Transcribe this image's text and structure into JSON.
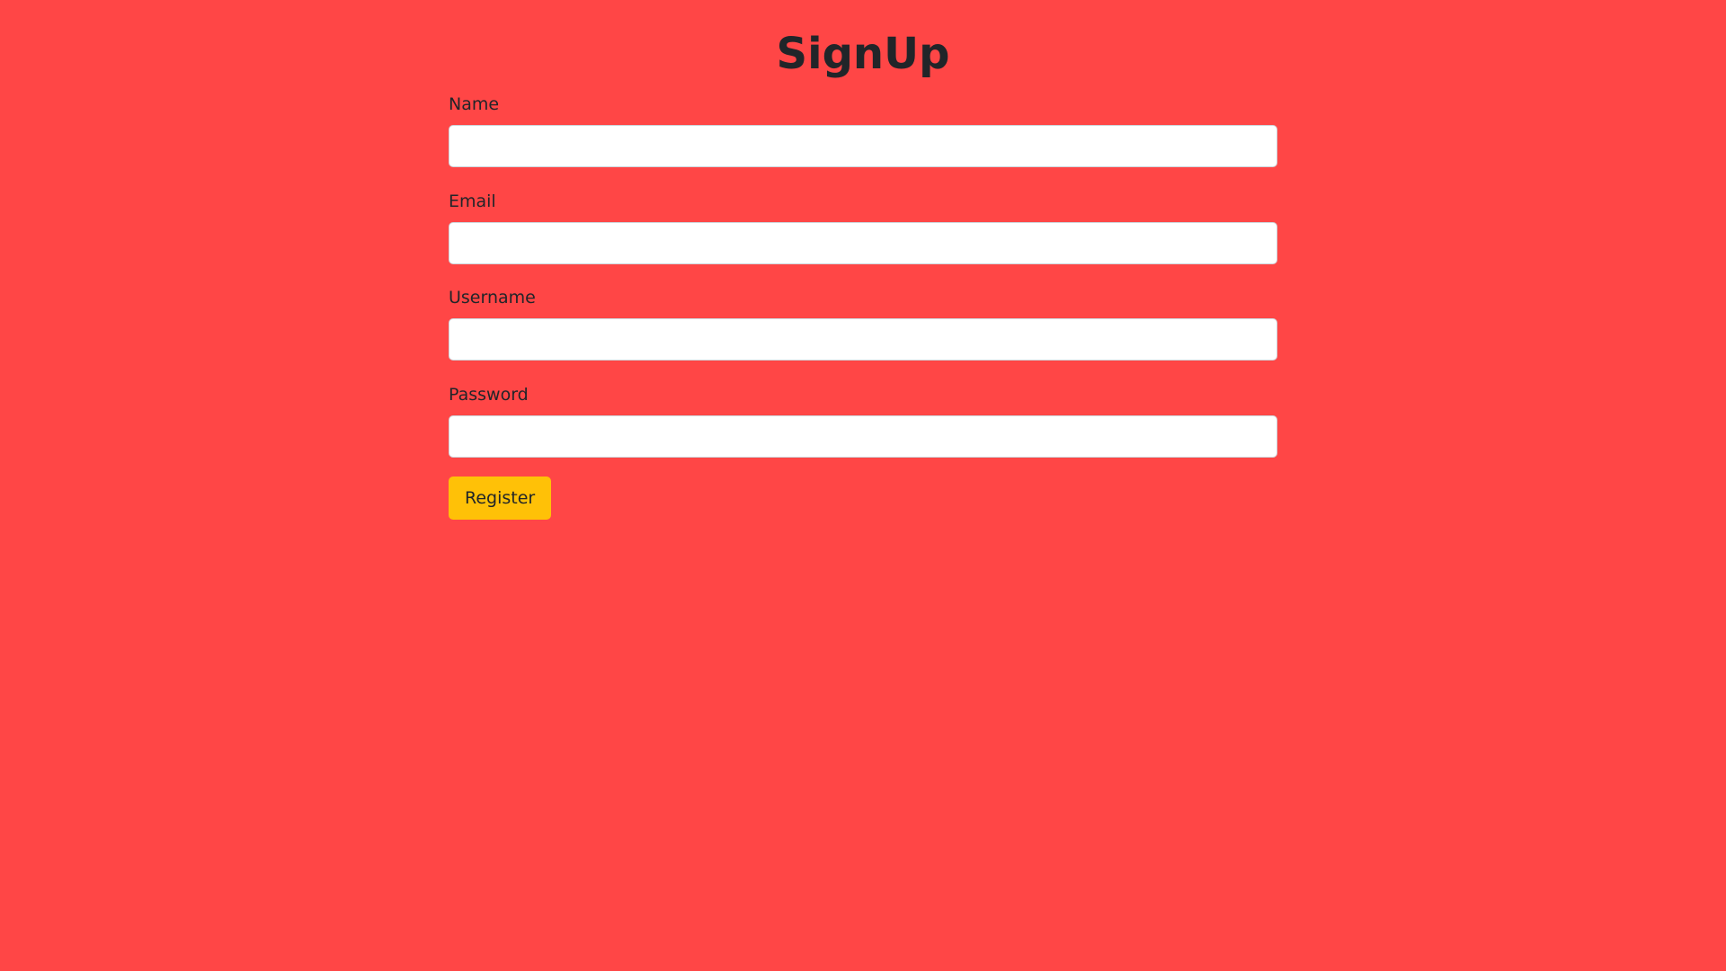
{
  "page": {
    "title": "SignUp",
    "background_color": "#ff4646"
  },
  "form": {
    "fields": [
      {
        "label": "Name",
        "value": "",
        "placeholder": ""
      },
      {
        "label": "Email",
        "value": "",
        "placeholder": ""
      },
      {
        "label": "Username",
        "value": "",
        "placeholder": ""
      },
      {
        "label": "Password",
        "value": "",
        "placeholder": ""
      }
    ],
    "submit": {
      "label": "Register",
      "color": "#ffc107"
    }
  }
}
